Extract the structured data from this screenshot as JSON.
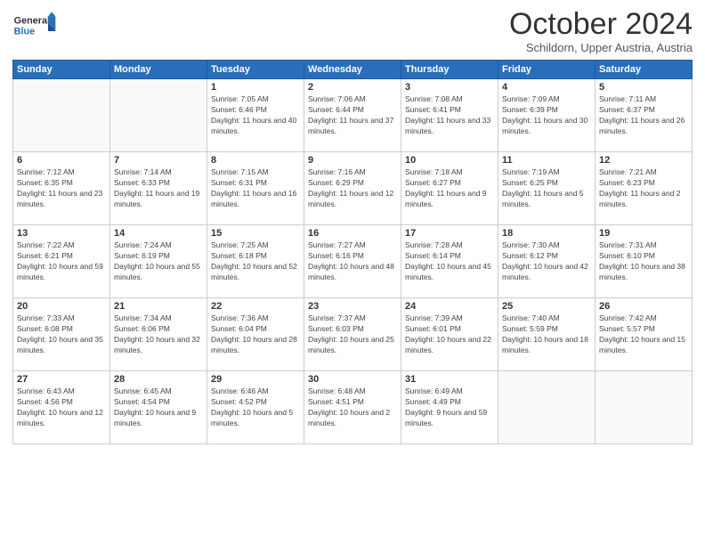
{
  "header": {
    "logo_general": "General",
    "logo_blue": "Blue",
    "month_title": "October 2024",
    "location": "Schildorn, Upper Austria, Austria"
  },
  "weekdays": [
    "Sunday",
    "Monday",
    "Tuesday",
    "Wednesday",
    "Thursday",
    "Friday",
    "Saturday"
  ],
  "weeks": [
    [
      {
        "day": "",
        "info": ""
      },
      {
        "day": "",
        "info": ""
      },
      {
        "day": "1",
        "info": "Sunrise: 7:05 AM\nSunset: 6:46 PM\nDaylight: 11 hours and 40 minutes."
      },
      {
        "day": "2",
        "info": "Sunrise: 7:06 AM\nSunset: 6:44 PM\nDaylight: 11 hours and 37 minutes."
      },
      {
        "day": "3",
        "info": "Sunrise: 7:08 AM\nSunset: 6:41 PM\nDaylight: 11 hours and 33 minutes."
      },
      {
        "day": "4",
        "info": "Sunrise: 7:09 AM\nSunset: 6:39 PM\nDaylight: 11 hours and 30 minutes."
      },
      {
        "day": "5",
        "info": "Sunrise: 7:11 AM\nSunset: 6:37 PM\nDaylight: 11 hours and 26 minutes."
      }
    ],
    [
      {
        "day": "6",
        "info": "Sunrise: 7:12 AM\nSunset: 6:35 PM\nDaylight: 11 hours and 23 minutes."
      },
      {
        "day": "7",
        "info": "Sunrise: 7:14 AM\nSunset: 6:33 PM\nDaylight: 11 hours and 19 minutes."
      },
      {
        "day": "8",
        "info": "Sunrise: 7:15 AM\nSunset: 6:31 PM\nDaylight: 11 hours and 16 minutes."
      },
      {
        "day": "9",
        "info": "Sunrise: 7:16 AM\nSunset: 6:29 PM\nDaylight: 11 hours and 12 minutes."
      },
      {
        "day": "10",
        "info": "Sunrise: 7:18 AM\nSunset: 6:27 PM\nDaylight: 11 hours and 9 minutes."
      },
      {
        "day": "11",
        "info": "Sunrise: 7:19 AM\nSunset: 6:25 PM\nDaylight: 11 hours and 5 minutes."
      },
      {
        "day": "12",
        "info": "Sunrise: 7:21 AM\nSunset: 6:23 PM\nDaylight: 11 hours and 2 minutes."
      }
    ],
    [
      {
        "day": "13",
        "info": "Sunrise: 7:22 AM\nSunset: 6:21 PM\nDaylight: 10 hours and 59 minutes."
      },
      {
        "day": "14",
        "info": "Sunrise: 7:24 AM\nSunset: 6:19 PM\nDaylight: 10 hours and 55 minutes."
      },
      {
        "day": "15",
        "info": "Sunrise: 7:25 AM\nSunset: 6:18 PM\nDaylight: 10 hours and 52 minutes."
      },
      {
        "day": "16",
        "info": "Sunrise: 7:27 AM\nSunset: 6:16 PM\nDaylight: 10 hours and 48 minutes."
      },
      {
        "day": "17",
        "info": "Sunrise: 7:28 AM\nSunset: 6:14 PM\nDaylight: 10 hours and 45 minutes."
      },
      {
        "day": "18",
        "info": "Sunrise: 7:30 AM\nSunset: 6:12 PM\nDaylight: 10 hours and 42 minutes."
      },
      {
        "day": "19",
        "info": "Sunrise: 7:31 AM\nSunset: 6:10 PM\nDaylight: 10 hours and 38 minutes."
      }
    ],
    [
      {
        "day": "20",
        "info": "Sunrise: 7:33 AM\nSunset: 6:08 PM\nDaylight: 10 hours and 35 minutes."
      },
      {
        "day": "21",
        "info": "Sunrise: 7:34 AM\nSunset: 6:06 PM\nDaylight: 10 hours and 32 minutes."
      },
      {
        "day": "22",
        "info": "Sunrise: 7:36 AM\nSunset: 6:04 PM\nDaylight: 10 hours and 28 minutes."
      },
      {
        "day": "23",
        "info": "Sunrise: 7:37 AM\nSunset: 6:03 PM\nDaylight: 10 hours and 25 minutes."
      },
      {
        "day": "24",
        "info": "Sunrise: 7:39 AM\nSunset: 6:01 PM\nDaylight: 10 hours and 22 minutes."
      },
      {
        "day": "25",
        "info": "Sunrise: 7:40 AM\nSunset: 5:59 PM\nDaylight: 10 hours and 18 minutes."
      },
      {
        "day": "26",
        "info": "Sunrise: 7:42 AM\nSunset: 5:57 PM\nDaylight: 10 hours and 15 minutes."
      }
    ],
    [
      {
        "day": "27",
        "info": "Sunrise: 6:43 AM\nSunset: 4:56 PM\nDaylight: 10 hours and 12 minutes."
      },
      {
        "day": "28",
        "info": "Sunrise: 6:45 AM\nSunset: 4:54 PM\nDaylight: 10 hours and 9 minutes."
      },
      {
        "day": "29",
        "info": "Sunrise: 6:46 AM\nSunset: 4:52 PM\nDaylight: 10 hours and 5 minutes."
      },
      {
        "day": "30",
        "info": "Sunrise: 6:48 AM\nSunset: 4:51 PM\nDaylight: 10 hours and 2 minutes."
      },
      {
        "day": "31",
        "info": "Sunrise: 6:49 AM\nSunset: 4:49 PM\nDaylight: 9 hours and 59 minutes."
      },
      {
        "day": "",
        "info": ""
      },
      {
        "day": "",
        "info": ""
      }
    ]
  ]
}
